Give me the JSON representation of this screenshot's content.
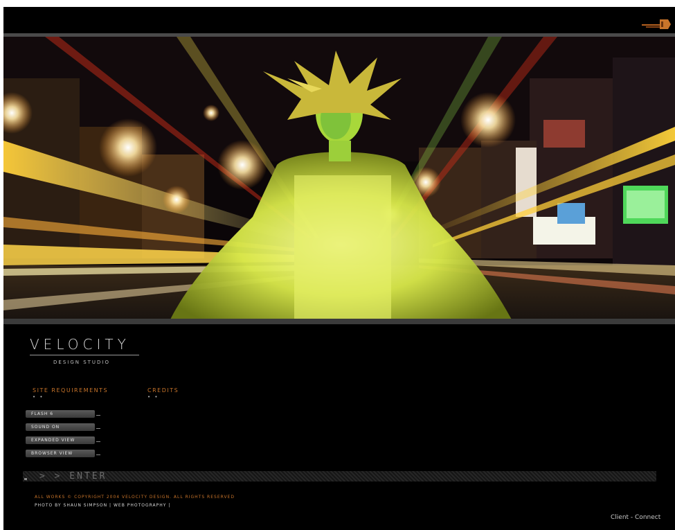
{
  "header": {
    "logo_icon": "velocity-corner-mark-icon"
  },
  "hero": {
    "image_description_icon": "hero-photo"
  },
  "brand": {
    "title": "VELOCITY",
    "subtitle": "DESIGN STUDIO"
  },
  "info": {
    "requirements_label": "SITE REQUIREMENTS",
    "requirements_dots": "• •",
    "credits_label": "CREDITS",
    "credits_dots": "• •"
  },
  "options": [
    {
      "label": "FLASH 6"
    },
    {
      "label": "SOUND ON"
    },
    {
      "label": "EXPANDED VIEW"
    },
    {
      "label": "BROWSER VIEW"
    }
  ],
  "enter": {
    "label": "> > ENTER"
  },
  "footer": {
    "copyright": "ALL WORKS © COPYRIGHT 2004 VELOCITY DESIGN. ALL RIGHTS RESERVED",
    "photo_credit_prefix": "PHOTO BY SHAUN SIMPSON |",
    "photo_credit_link": "WEB PHOTOGRAPHY",
    "photo_credit_suffix": "|",
    "client_connect": "Client - Connect"
  },
  "colors": {
    "accent": "#c8742a",
    "background": "#000000",
    "rule": "#4a4a4a"
  }
}
